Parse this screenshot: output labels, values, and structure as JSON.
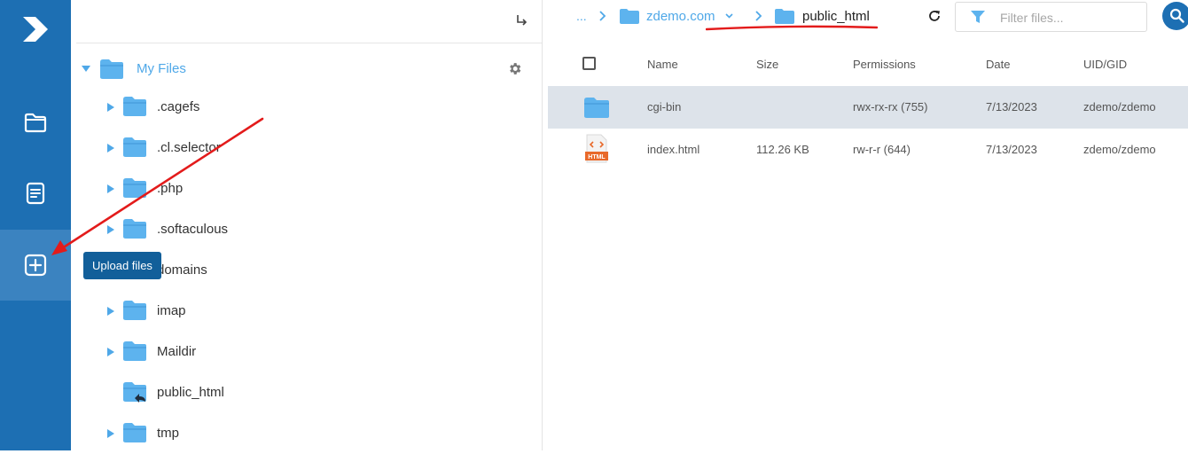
{
  "tooltip": {
    "upload_files": "Upload files"
  },
  "tree": {
    "root_label": "My Files",
    "nodes": [
      {
        "label": ".cagefs"
      },
      {
        "label": ".cl.selector"
      },
      {
        "label": ".php"
      },
      {
        "label": ".softaculous"
      },
      {
        "label": "domains"
      },
      {
        "label": "imap"
      },
      {
        "label": "Maildir"
      },
      {
        "label": "public_html"
      },
      {
        "label": "tmp"
      }
    ]
  },
  "breadcrumb": {
    "more": "...",
    "domain": "zdemo.com",
    "current": "public_html"
  },
  "filter": {
    "placeholder": "Filter files..."
  },
  "table": {
    "headers": {
      "name": "Name",
      "size": "Size",
      "permissions": "Permissions",
      "date": "Date",
      "uid": "UID/GID"
    },
    "rows": [
      {
        "name": "cgi-bin",
        "size": "",
        "permissions": "rwx-rx-rx (755)",
        "date": "7/13/2023",
        "uid": "zdemo/zdemo"
      },
      {
        "name": "index.html",
        "size": "112.26 KB",
        "permissions": "rw-r-r (644)",
        "date": "7/13/2023",
        "uid": "zdemo/zdemo"
      }
    ]
  },
  "icons": {
    "html_badge": "HTML"
  },
  "colors": {
    "brand": "#1d6fb3",
    "folder": "#5db3ee",
    "accent_text": "#4fa8e8",
    "annotation_red": "#e31b1b",
    "selected_row": "#dde3ea"
  }
}
